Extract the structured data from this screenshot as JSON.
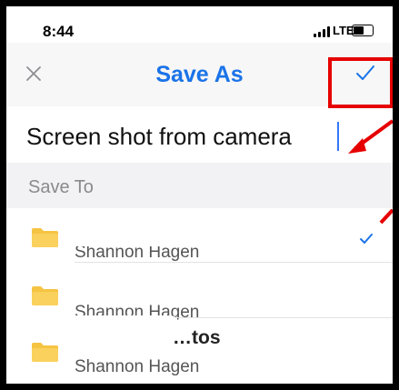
{
  "status_bar": {
    "time": "8:44",
    "network": "LTE"
  },
  "nav": {
    "title": "Save As"
  },
  "filename": {
    "value": "Screen shot from camera"
  },
  "save_to": {
    "label": "Save To"
  },
  "locations": [
    {
      "title": "",
      "subtitle": "Shannon Hagen",
      "selected": true
    },
    {
      "title": "",
      "subtitle": "Shannon Hagen",
      "selected": false
    },
    {
      "title": "…tos",
      "subtitle": "Shannon Hagen",
      "selected": false
    }
  ],
  "colors": {
    "accent": "#1a73e8",
    "folder": "#f6c443",
    "annotation": "#e60000"
  },
  "icons": {
    "close": "close-icon",
    "confirm": "checkmark-icon",
    "folder": "folder-icon",
    "selected": "checkmark-icon"
  }
}
